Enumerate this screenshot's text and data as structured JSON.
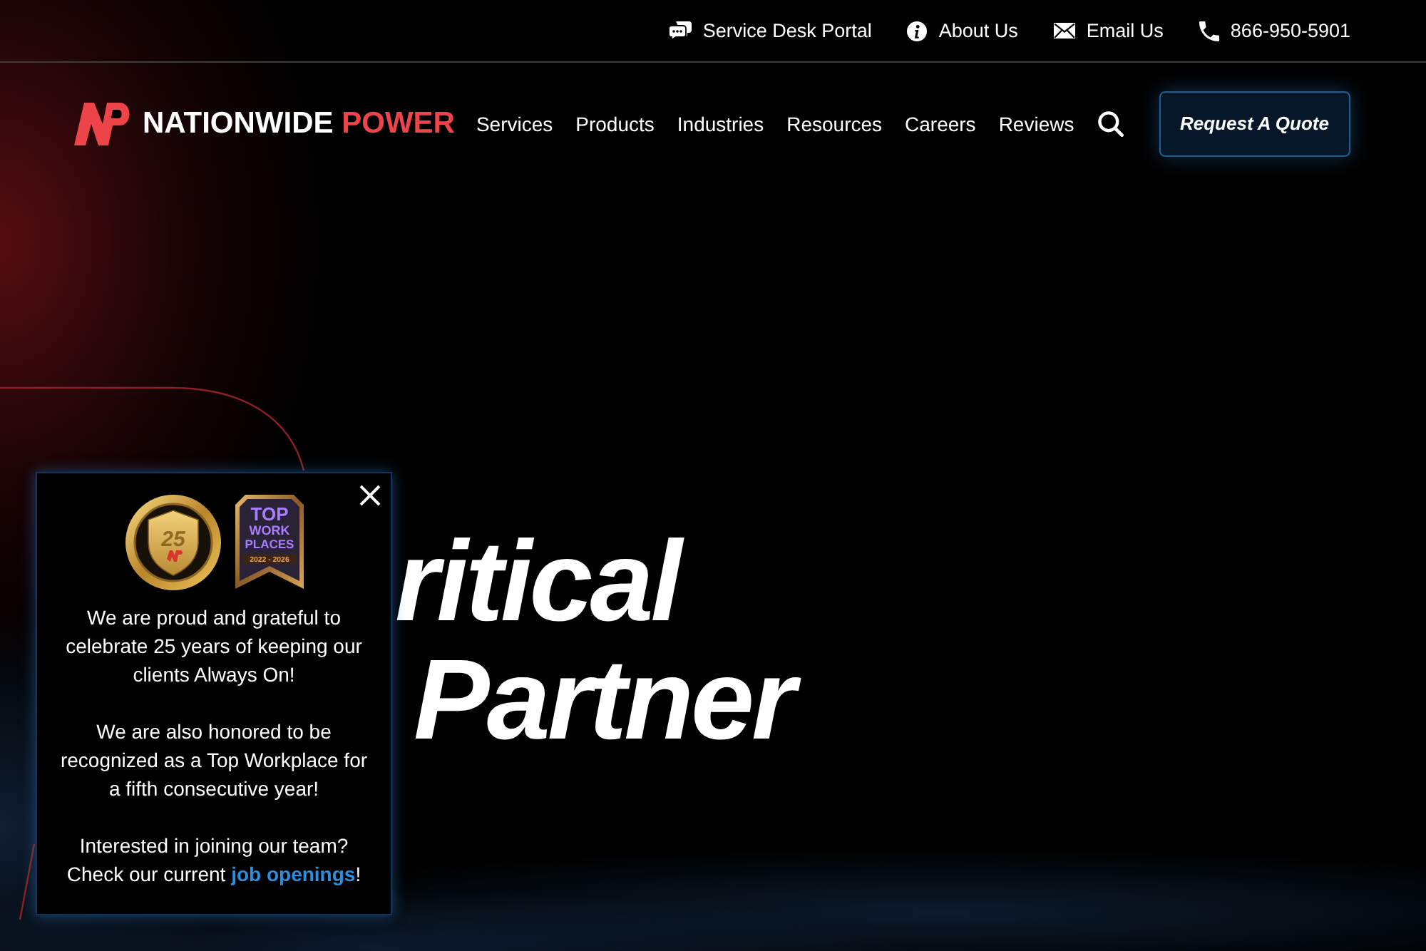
{
  "top_bar": {
    "links": [
      {
        "kind": "chat",
        "label": "Service Desk Portal"
      },
      {
        "kind": "info",
        "label": "About Us"
      },
      {
        "kind": "mail",
        "label": "Email Us"
      },
      {
        "kind": "phone",
        "label": "866-950-5901"
      }
    ]
  },
  "header": {
    "logo": {
      "name": "NATIONWIDE",
      "accent": "POWER"
    },
    "nav": [
      "Services",
      "Products",
      "Industries",
      "Resources",
      "Careers",
      "Reviews"
    ],
    "cta": "Request A Quote"
  },
  "hero": {
    "headline_lines": [
      "ritical",
      "Partner"
    ]
  },
  "popup": {
    "badges": [
      {
        "kind": "medal",
        "text": "25"
      },
      {
        "kind": "ribbon",
        "lines": [
          "TOP",
          "WORK",
          "PLACES"
        ],
        "years": "2022 - 2026"
      }
    ],
    "paragraphs": [
      {
        "text": "We are proud and grateful to celebrate 25 years of keeping our clients Always On!"
      },
      {
        "text": "We are also honored to be recognized as a Top Workplace for a fifth consecutive year!"
      },
      {
        "text": "Interested in joining our team? Check our current ",
        "link": "job openings",
        "after": "!"
      }
    ]
  }
}
